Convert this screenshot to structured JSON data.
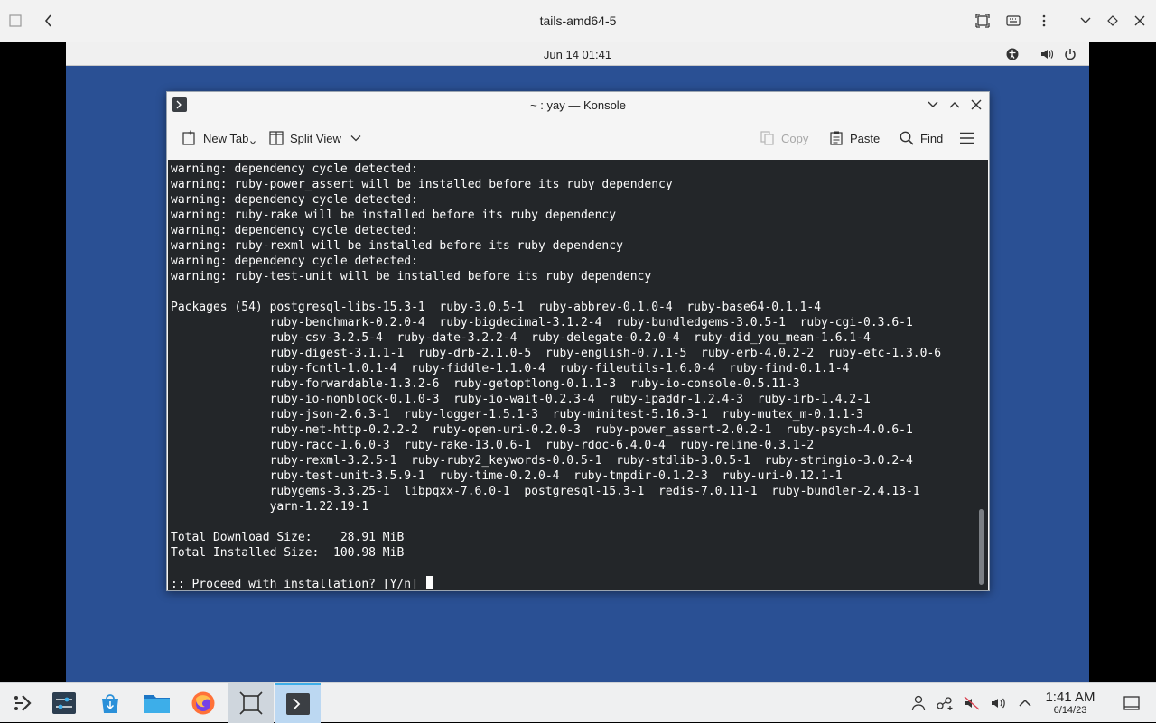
{
  "host": {
    "title": "tails-amd64-5"
  },
  "vm_topbar": {
    "clock": "Jun 14  01:41"
  },
  "konsole": {
    "title": "~ : yay — Konsole",
    "toolbar": {
      "new_tab": "New Tab",
      "split_view": "Split View",
      "copy": "Copy",
      "paste": "Paste",
      "find": "Find"
    },
    "terminal_lines": [
      "warning: dependency cycle detected:",
      "warning: ruby-power_assert will be installed before its ruby dependency",
      "warning: dependency cycle detected:",
      "warning: ruby-rake will be installed before its ruby dependency",
      "warning: dependency cycle detected:",
      "warning: ruby-rexml will be installed before its ruby dependency",
      "warning: dependency cycle detected:",
      "warning: ruby-test-unit will be installed before its ruby dependency",
      "",
      "Packages (54) postgresql-libs-15.3-1  ruby-3.0.5-1  ruby-abbrev-0.1.0-4  ruby-base64-0.1.1-4",
      "              ruby-benchmark-0.2.0-4  ruby-bigdecimal-3.1.2-4  ruby-bundledgems-3.0.5-1  ruby-cgi-0.3.6-1",
      "              ruby-csv-3.2.5-4  ruby-date-3.2.2-4  ruby-delegate-0.2.0-4  ruby-did_you_mean-1.6.1-4",
      "              ruby-digest-3.1.1-1  ruby-drb-2.1.0-5  ruby-english-0.7.1-5  ruby-erb-4.0.2-2  ruby-etc-1.3.0-6",
      "              ruby-fcntl-1.0.1-4  ruby-fiddle-1.1.0-4  ruby-fileutils-1.6.0-4  ruby-find-0.1.1-4",
      "              ruby-forwardable-1.3.2-6  ruby-getoptlong-0.1.1-3  ruby-io-console-0.5.11-3",
      "              ruby-io-nonblock-0.1.0-3  ruby-io-wait-0.2.3-4  ruby-ipaddr-1.2.4-3  ruby-irb-1.4.2-1",
      "              ruby-json-2.6.3-1  ruby-logger-1.5.1-3  ruby-minitest-5.16.3-1  ruby-mutex_m-0.1.1-3",
      "              ruby-net-http-0.2.2-2  ruby-open-uri-0.2.0-3  ruby-power_assert-2.0.2-1  ruby-psych-4.0.6-1",
      "              ruby-racc-1.6.0-3  ruby-rake-13.0.6-1  ruby-rdoc-6.4.0-4  ruby-reline-0.3.1-2",
      "              ruby-rexml-3.2.5-1  ruby-ruby2_keywords-0.0.5-1  ruby-stdlib-3.0.5-1  ruby-stringio-3.0.2-4",
      "              ruby-test-unit-3.5.9-1  ruby-time-0.2.0-4  ruby-tmpdir-0.1.2-3  ruby-uri-0.12.1-1",
      "              rubygems-3.3.25-1  libpqxx-7.6.0-1  postgresql-15.3-1  redis-7.0.11-1  ruby-bundler-2.4.13-1",
      "              yarn-1.22.19-1",
      "",
      "Total Download Size:    28.91 MiB",
      "Total Installed Size:  100.98 MiB",
      "",
      ":: Proceed with installation? [Y/n] "
    ]
  },
  "taskbar": {
    "time": "1:41 AM",
    "date": "6/14/23"
  },
  "colors": {
    "desktop": "#2a5094",
    "terminal_bg": "#232629",
    "terminal_fg": "#fcfcfc",
    "accent": "#3daee9"
  }
}
